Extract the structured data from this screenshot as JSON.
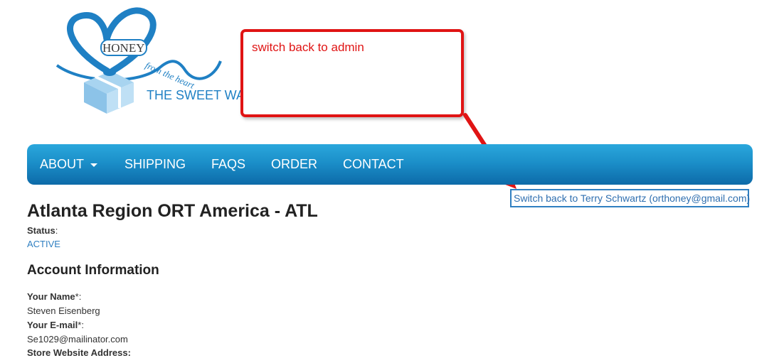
{
  "logo": {
    "brand_word": "HONEY",
    "tagline": "from the heart",
    "subtitle": "THE SWEET WA"
  },
  "callout": {
    "text": "switch back to admin"
  },
  "nav": {
    "items": [
      {
        "label": "ABOUT",
        "has_dropdown": true
      },
      {
        "label": "SHIPPING"
      },
      {
        "label": "FAQS"
      },
      {
        "label": "ORDER"
      },
      {
        "label": "CONTACT"
      }
    ]
  },
  "switch_back": {
    "label": "Switch back to Terry Schwartz (orthoney@gmail.com)"
  },
  "page": {
    "title": "Atlanta Region ORT America - ATL",
    "status_label": "Status",
    "status_colon": ":",
    "status_value": "ACTIVE"
  },
  "account": {
    "heading": "Account Information",
    "name_label": "Your Name",
    "name_required": "*:",
    "name_value": "Steven Eisenberg",
    "email_label": "Your E-mail",
    "email_required": "*:",
    "email_value": "Se1029@mailinator.com",
    "website_label": "Store Website Address:"
  },
  "colors": {
    "accent_blue": "#1f80c4",
    "annotation_red": "#e01414",
    "nav_gradient_top": "#2aa7dc",
    "nav_gradient_bottom": "#0d6aa8"
  }
}
